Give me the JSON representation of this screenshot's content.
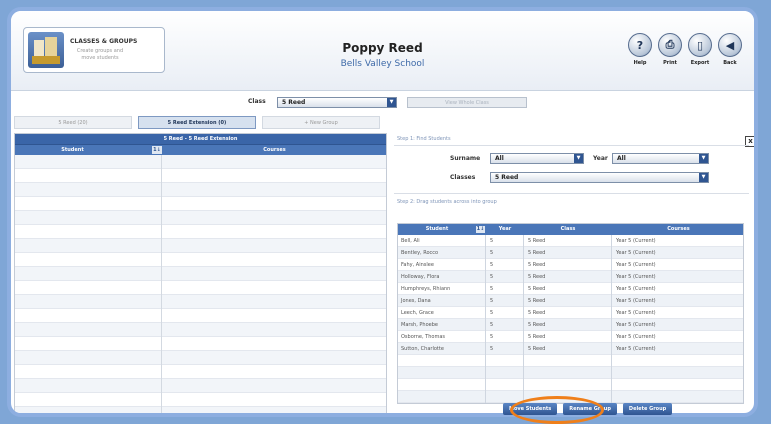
{
  "header": {
    "logo_title": "CLASSES & GROUPS",
    "logo_subtitle": "Create groups and move students",
    "student_name": "Poppy Reed",
    "school_name": "Bells Valley School",
    "icons": [
      {
        "label": "Help",
        "glyph": "?",
        "icon": "help-icon"
      },
      {
        "label": "Print",
        "glyph": "⎙",
        "icon": "print-icon"
      },
      {
        "label": "Export",
        "glyph": "▯",
        "icon": "export-icon"
      },
      {
        "label": "Back",
        "glyph": "◀",
        "icon": "back-icon"
      }
    ]
  },
  "class_bar": {
    "label": "Class",
    "selected": "5 Reed",
    "view_button": "View Whole Class"
  },
  "tabs": [
    {
      "label": "5 Reed (20)",
      "active": false
    },
    {
      "label": "5 Reed Extension (0)",
      "active": true
    },
    {
      "label": "+ New Group",
      "active": false
    }
  ],
  "left_panel": {
    "title": "5 Reed - 5 Reed Extension",
    "col_student": "Student",
    "sort_glyph": "1↓",
    "col_courses": "Courses"
  },
  "right_panel": {
    "close_glyph": "x",
    "step1": "Step 1: Find Students",
    "surname_label": "Surname",
    "surname_value": "All",
    "year_label": "Year",
    "year_value": "All",
    "classes_label": "Classes",
    "classes_value": "5 Reed",
    "step2": "Step 2: Drag students across into group",
    "grid_headers": {
      "student": "Student",
      "sort": "1↓",
      "year": "Year",
      "class": "Class",
      "courses": "Courses"
    },
    "rows": [
      {
        "student": "Bell, Ali",
        "year": "5",
        "class": "5 Reed",
        "courses": "Year 5 (Current)"
      },
      {
        "student": "Bentley, Rocco",
        "year": "5",
        "class": "5 Reed",
        "courses": "Year 5 (Current)"
      },
      {
        "student": "Fahy, Ainslee",
        "year": "5",
        "class": "5 Reed",
        "courses": "Year 5 (Current)"
      },
      {
        "student": "Holloway, Flora",
        "year": "5",
        "class": "5 Reed",
        "courses": "Year 5 (Current)"
      },
      {
        "student": "Humphreys, Rhiann",
        "year": "5",
        "class": "5 Reed",
        "courses": "Year 5 (Current)"
      },
      {
        "student": "Jones, Dana",
        "year": "5",
        "class": "5 Reed",
        "courses": "Year 5 (Current)"
      },
      {
        "student": "Leech, Grace",
        "year": "5",
        "class": "5 Reed",
        "courses": "Year 5 (Current)"
      },
      {
        "student": "Marsh, Phoebe",
        "year": "5",
        "class": "5 Reed",
        "courses": "Year 5 (Current)"
      },
      {
        "student": "Osborne, Thomas",
        "year": "5",
        "class": "5 Reed",
        "courses": "Year 5 (Current)"
      },
      {
        "student": "Sutton, Charlotte",
        "year": "5",
        "class": "5 Reed",
        "courses": "Year 5 (Current)"
      }
    ]
  },
  "actions": {
    "move": "Move Students",
    "rename": "Rename Group",
    "delete": "Delete Group"
  },
  "colors": {
    "accent": "#2f5591",
    "highlight": "#ef7f1a"
  }
}
